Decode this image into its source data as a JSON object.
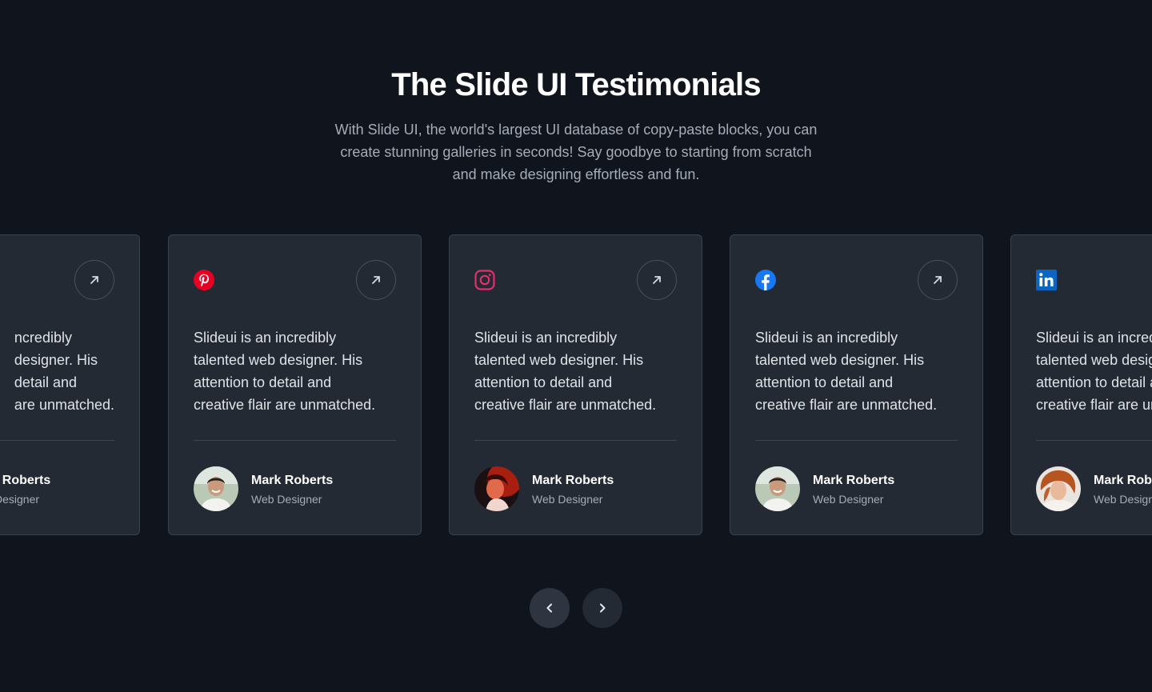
{
  "header": {
    "title": "The Slide UI Testimonials",
    "subtitle_lines": [
      "With Slide UI, the world's largest UI database of copy-paste blocks, you can",
      "create stunning galleries in seconds! Say goodbye to starting from scratch",
      "and make designing effortless and fun."
    ]
  },
  "testimonials": [
    {
      "social_icon": "none",
      "quote_lines": [
        "ncredibly",
        "designer. His",
        "detail and",
        "are unmatched."
      ],
      "name": "t Roberts",
      "role": "Designer",
      "avatar": "none"
    },
    {
      "social_icon": "pinterest-icon",
      "quote_lines": [
        "Slideui is an incredibly",
        "talented web designer. His",
        "attention to detail and",
        "creative flair are unmatched."
      ],
      "name": "Mark Roberts",
      "role": "Web Designer",
      "avatar": "smiling-man"
    },
    {
      "social_icon": "instagram-icon",
      "quote_lines": [
        "Slideui is an incredibly",
        "talented web designer. His",
        "attention to detail and",
        "creative flair are unmatched."
      ],
      "name": "Mark Roberts",
      "role": "Web Designer",
      "avatar": "woman-red-light"
    },
    {
      "social_icon": "facebook-icon",
      "quote_lines": [
        "Slideui is an incredibly",
        "talented web designer. His",
        "attention to detail and",
        "creative flair are unmatched."
      ],
      "name": "Mark Roberts",
      "role": "Web Designer",
      "avatar": "smiling-man"
    },
    {
      "social_icon": "linkedin-icon",
      "quote_lines": [
        "Slideui is an incredibly",
        "talented web designer. His",
        "attention to detail and",
        "creative flair are unmatched."
      ],
      "name": "Mark Roberts",
      "role": "Web Designer",
      "avatar": "red-haired-woman"
    }
  ],
  "navigation": {
    "prev_icon": "chevron-left-icon",
    "next_icon": "chevron-right-icon"
  },
  "colors": {
    "background": "#0f141d",
    "card": "#242a33",
    "card_border": "#3a414b",
    "muted_text": "#a5adb9",
    "pinterest": "#e60023",
    "instagram": "#e1306c",
    "facebook": "#1877f2",
    "linkedin": "#0a66c2"
  }
}
